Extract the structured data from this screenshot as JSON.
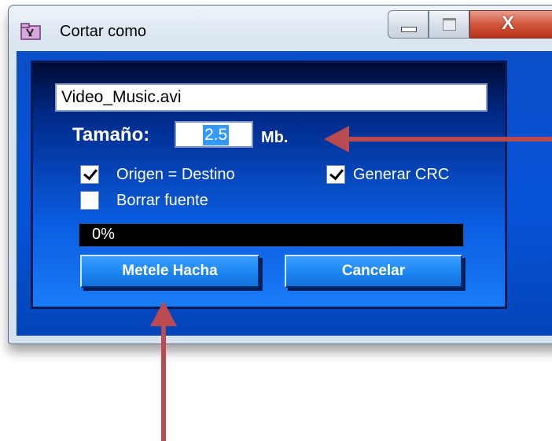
{
  "window": {
    "title": "Cortar como"
  },
  "form": {
    "filename": "Video_Music.avi",
    "size_label": "Tamaño:",
    "size_value": "2.5",
    "size_unit": "Mb.",
    "checkbox_origen": {
      "label": "Origen = Destino",
      "checked": true
    },
    "checkbox_crc": {
      "label": "Generar CRC",
      "checked": true
    },
    "checkbox_borrar": {
      "label": "Borrar fuente",
      "checked": false
    },
    "progress": {
      "text": "0%",
      "fraction": 0
    },
    "buttons": {
      "primary": "Metele Hacha",
      "cancel": "Cancelar"
    }
  },
  "colors": {
    "annotation_arrow": "#b84a50",
    "accent": "#1a82f0",
    "close_button": "#c8432a"
  },
  "icons": {
    "app": "scissors-folder-icon",
    "minimize": "minimize-icon",
    "maximize": "maximize-icon",
    "close": "close-icon"
  }
}
